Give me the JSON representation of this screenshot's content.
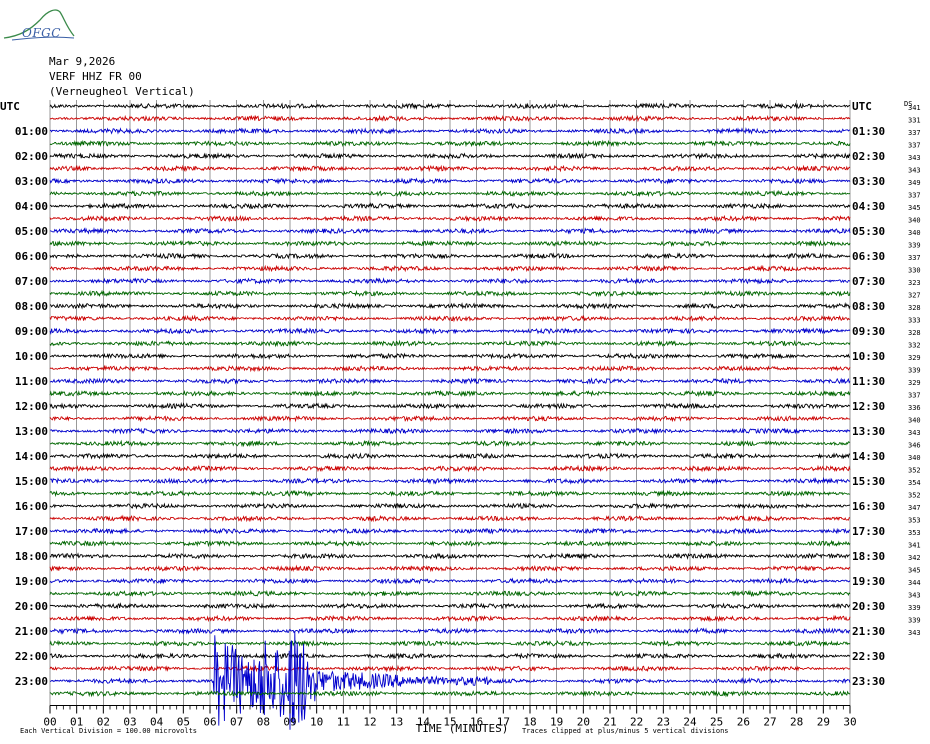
{
  "header": {
    "logo_text": "OFGC",
    "date": "Mar 9,2026",
    "station": "VERF HHZ FR 00",
    "station_name": "(Verneugheol Vertical)"
  },
  "chart_data": {
    "type": "line",
    "title": "Mar 9,2026  VERF HHZ FR 00  (Verneugheol Vertical)",
    "left_axis_label": "UTC",
    "right_axis_label": "UTC",
    "ds_label": "DS",
    "xlabel": "TIME (MINUTES)",
    "xlim": [
      0,
      30
    ],
    "x_ticks": [
      "00",
      "01",
      "02",
      "03",
      "04",
      "05",
      "06",
      "07",
      "08",
      "09",
      "10",
      "11",
      "12",
      "13",
      "14",
      "15",
      "16",
      "17",
      "18",
      "19",
      "20",
      "21",
      "22",
      "23",
      "24",
      "25",
      "26",
      "27",
      "28",
      "29",
      "30"
    ],
    "left_hour_labels": [
      "UTC",
      "01:00",
      "02:00",
      "03:00",
      "04:00",
      "05:00",
      "06:00",
      "07:00",
      "08:00",
      "09:00",
      "10:00",
      "11:00",
      "12:00",
      "13:00",
      "14:00",
      "15:00",
      "16:00",
      "17:00",
      "18:00",
      "19:00",
      "20:00",
      "21:00",
      "22:00",
      "23:00"
    ],
    "right_hour_labels": [
      "UTC",
      "01:30",
      "02:30",
      "03:30",
      "04:30",
      "05:30",
      "06:30",
      "07:30",
      "08:30",
      "09:30",
      "10:30",
      "11:30",
      "12:30",
      "13:30",
      "14:30",
      "15:30",
      "16:30",
      "17:30",
      "18:30",
      "19:30",
      "20:30",
      "21:30",
      "22:30",
      "23:30"
    ],
    "trace_colors": [
      "#000000",
      "#cc0000",
      "#0000cc",
      "#006600"
    ],
    "num_traces": 48,
    "ds_values": [
      "341",
      "331",
      "337",
      "337",
      "343",
      "343",
      "349",
      "337",
      "345",
      "340",
      "340",
      "339",
      "337",
      "330",
      "323",
      "327",
      "328",
      "333",
      "328",
      "332",
      "329",
      "339",
      "329",
      "337",
      "336",
      "340",
      "343",
      "346",
      "340",
      "352",
      "354",
      "352",
      "347",
      "353",
      "353",
      "341",
      "342",
      "345",
      "344",
      "343",
      "339",
      "339",
      "343"
    ],
    "event": {
      "description_trace_index": 46,
      "start_minute": 6.15,
      "peak_minute": 9.2,
      "end_minute": 16.5,
      "peak_clip_divisions": 5
    },
    "footer_left": "Each Vertical Division =  100.00 microvolts",
    "footer_right": "Traces clipped at plus/minus 5 vertical divisions",
    "grid": true
  }
}
